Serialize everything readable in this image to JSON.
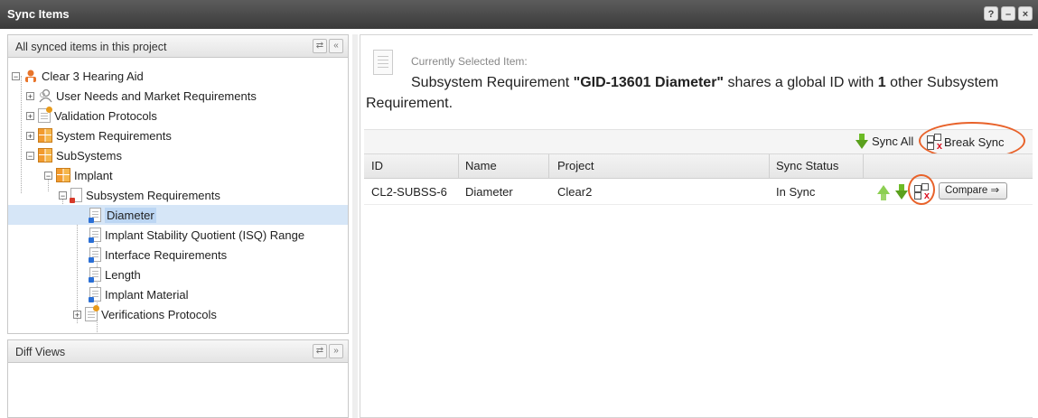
{
  "window": {
    "title": "Sync Items",
    "help_label": "?",
    "minimize_label": "–",
    "close_label": "×"
  },
  "left_panel": {
    "title": "All synced items in this project",
    "tree": [
      {
        "label": "Clear 3 Hearing Aid",
        "icon": "project-icon"
      },
      {
        "label": "User Needs and Market Requirements",
        "icon": "user-needs-icon"
      },
      {
        "label": "Validation Protocols",
        "icon": "validation-icon"
      },
      {
        "label": "System Requirements",
        "icon": "folder-icon"
      },
      {
        "label": "SubSystems",
        "icon": "folder-icon"
      },
      {
        "label": "Implant",
        "icon": "folder-icon"
      },
      {
        "label": "Subsystem Requirements",
        "icon": "document-icon"
      },
      {
        "label": "Diameter",
        "icon": "document-icon",
        "selected": true
      },
      {
        "label": "Implant Stability Quotient (ISQ) Range",
        "icon": "document-icon"
      },
      {
        "label": "Interface Requirements",
        "icon": "document-icon"
      },
      {
        "label": "Length",
        "icon": "document-icon"
      },
      {
        "label": "Implant Material",
        "icon": "document-icon"
      },
      {
        "label": "Verifications Protocols",
        "icon": "validation-icon"
      }
    ]
  },
  "diff_panel": {
    "title": "Diff Views"
  },
  "selection": {
    "label": "Currently Selected Item:",
    "desc_prefix": "Subsystem Requirement ",
    "item_name": "\"GID-13601 Diameter\"",
    "desc_mid": " shares a global ID with ",
    "count": "1",
    "desc_suffix": " other Subsystem Requirement."
  },
  "toolbar": {
    "sync_all": "Sync All",
    "break_sync": "Break Sync"
  },
  "table": {
    "columns": [
      "ID",
      "Name",
      "Project",
      "Sync Status"
    ],
    "rows": [
      {
        "id": "CL2-SUBSS-6",
        "name": "Diameter",
        "project": "Clear2",
        "status": "In Sync",
        "action": "Compare ⇒"
      }
    ]
  },
  "colors": {
    "highlight_ring": "#e8622a",
    "selected_row": "#d6e6f7",
    "arrow_green": "#5aa01d"
  }
}
